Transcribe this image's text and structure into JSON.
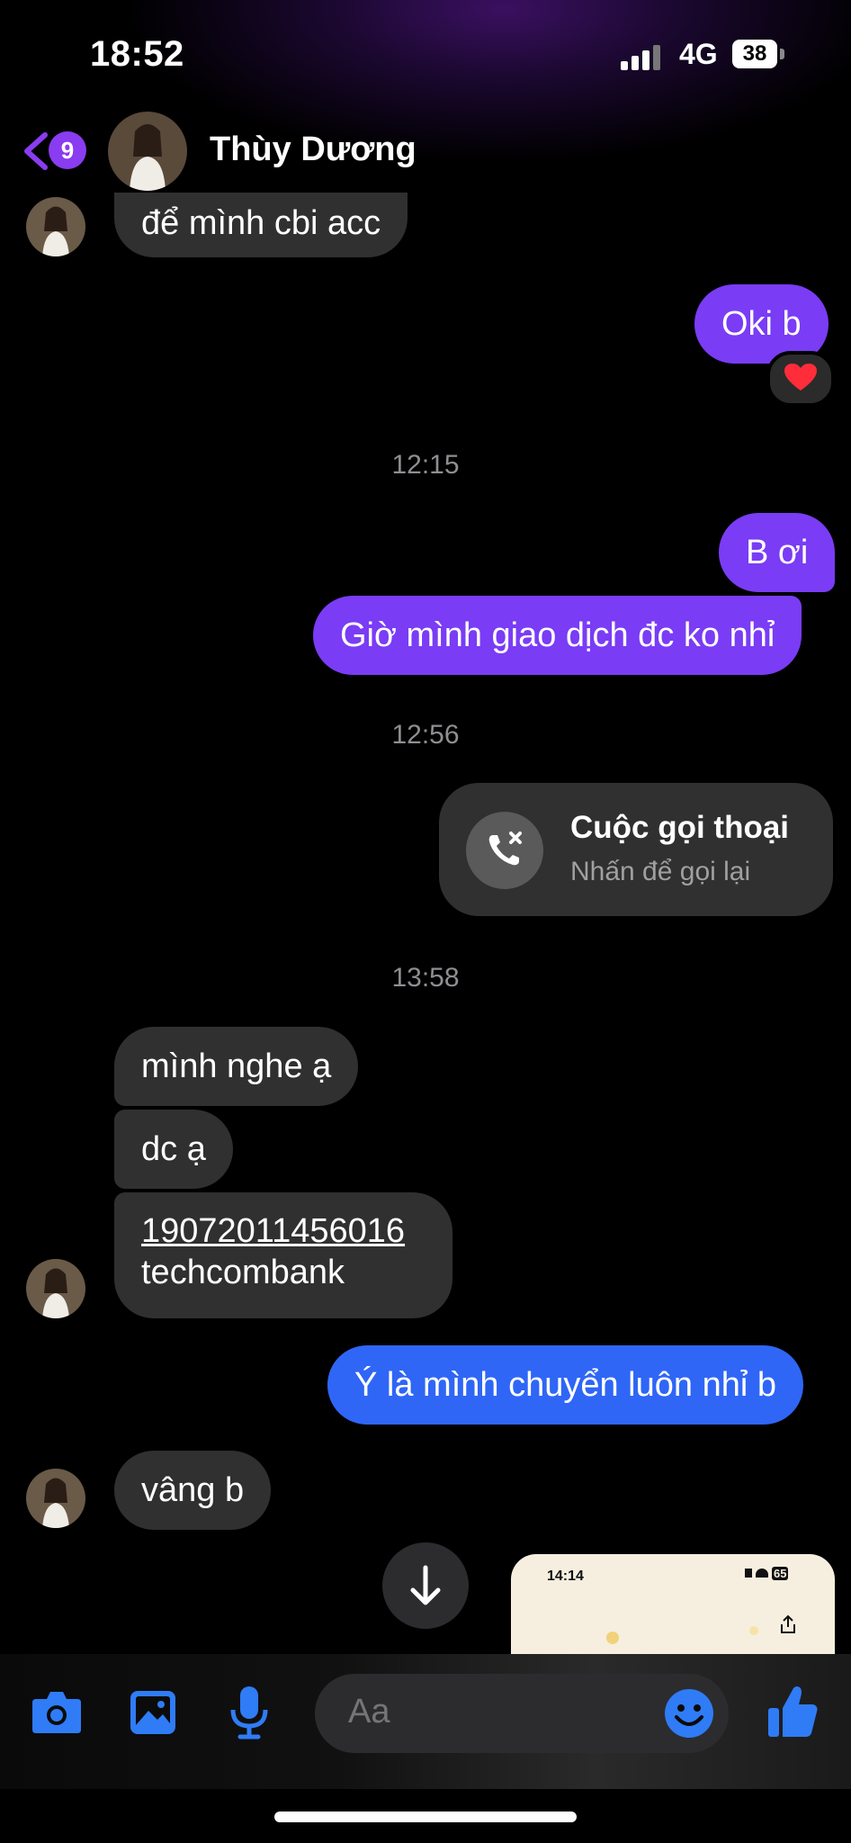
{
  "status": {
    "time": "18:52",
    "network": "4G",
    "battery": "38"
  },
  "header": {
    "unread_count": "9",
    "contact_name": "Thùy Dương"
  },
  "messages": {
    "m1": "để mình cbi acc",
    "m2": "Oki b",
    "reaction": "❤️",
    "t1": "12:15",
    "m3": "B ơi",
    "m4": "Giờ mình giao dịch đc ko nhỉ",
    "t2": "12:56",
    "call_title": "Cuộc gọi thoại",
    "call_sub": "Nhấn để gọi lại",
    "t3": "13:58",
    "m5": "mình nghe ạ",
    "m6": "dc ạ",
    "m7_line1": "19072011456016",
    "m7_line2": "techcombank",
    "m8": "Ý là mình chuyển luôn nhỉ b",
    "m9": "vâng b"
  },
  "preview": {
    "time": "14:14",
    "battery": "65"
  },
  "composer": {
    "placeholder": "Aa"
  },
  "colors": {
    "purple": "#7a3cf5",
    "blue": "#2f66f6",
    "incoming": "#303030",
    "accent_icon": "#2f7cf6"
  }
}
